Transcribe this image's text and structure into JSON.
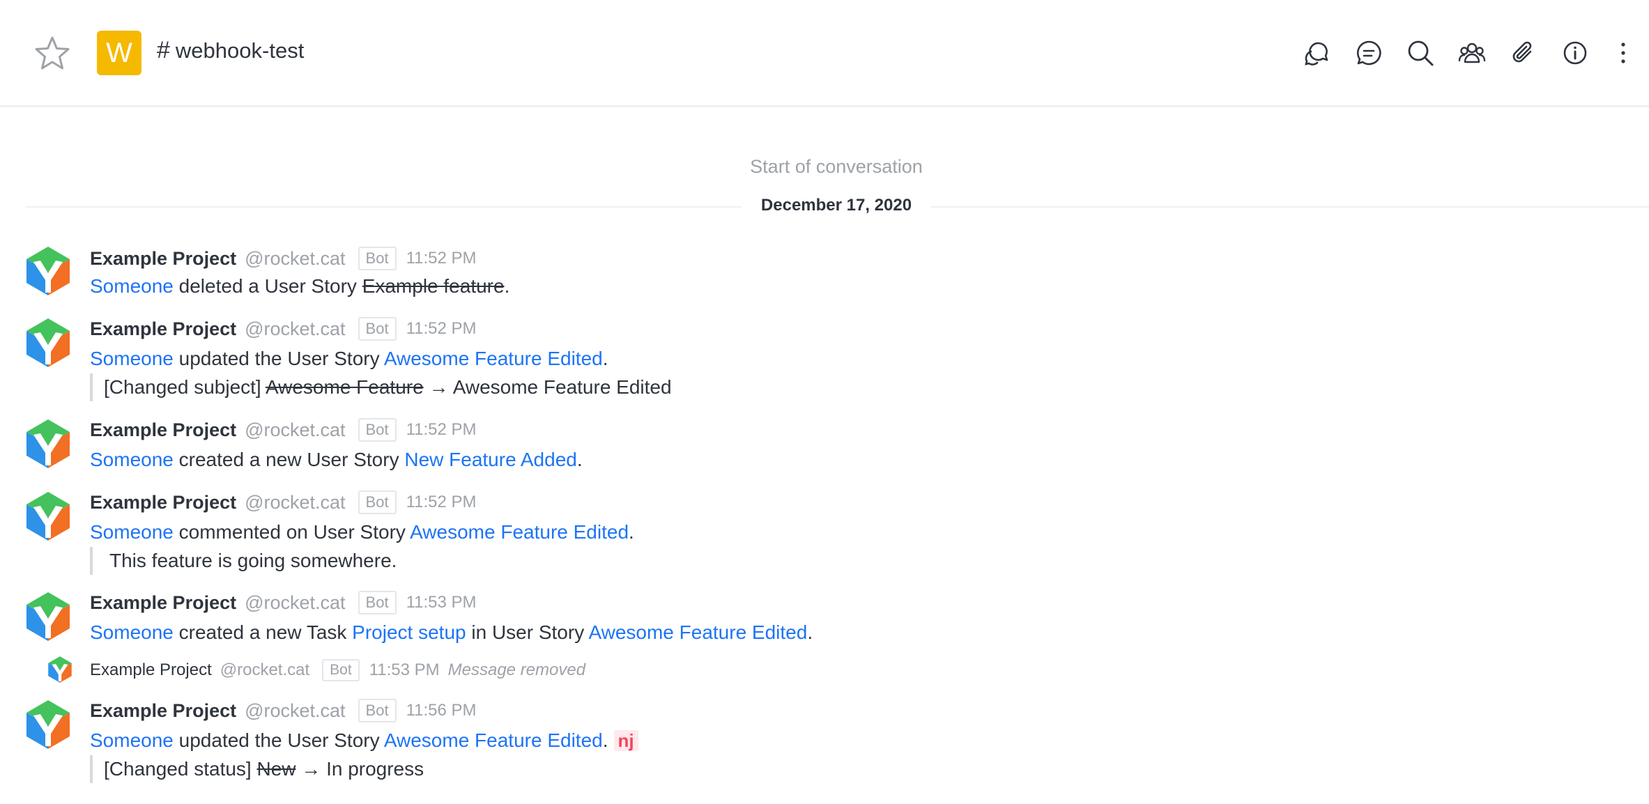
{
  "room": {
    "avatar_letter": "W",
    "hash": "#",
    "name": "webhook-test",
    "avatar_color": "#f5b900"
  },
  "toolbar": {
    "icons": [
      "threads-icon",
      "discussions-icon",
      "search-icon",
      "members-icon",
      "files-icon",
      "info-icon",
      "kebab-menu-icon"
    ]
  },
  "conversation": {
    "start_label": "Start of conversation",
    "date": "December 17, 2020"
  },
  "messages": [
    {
      "name": "Example Project",
      "username": "@rocket.cat",
      "badge": "Bot",
      "time": "11:52 PM",
      "parts": {
        "actor": "Someone",
        "t1": " deleted a User Story ",
        "struck": "Example feature",
        "t2": "."
      }
    },
    {
      "name": "Example Project",
      "username": "@rocket.cat",
      "badge": "Bot",
      "time": "11:52 PM",
      "parts": {
        "actor": "Someone",
        "t1": " updated the User Story ",
        "link": "Awesome Feature Edited",
        "t2": "."
      },
      "quote": {
        "prefix": "[Changed subject] ",
        "struck": "Awesome Feature",
        "arrow": " → ",
        "after": "Awesome Feature Edited"
      }
    },
    {
      "name": "Example Project",
      "username": "@rocket.cat",
      "badge": "Bot",
      "time": "11:52 PM",
      "parts": {
        "actor": "Someone",
        "t1": " created a new User Story ",
        "link": "New Feature Added",
        "t2": "."
      }
    },
    {
      "name": "Example Project",
      "username": "@rocket.cat",
      "badge": "Bot",
      "time": "11:52 PM",
      "parts": {
        "actor": "Someone",
        "t1": " commented on User Story ",
        "link": "Awesome Feature Edited",
        "t2": "."
      },
      "quote": {
        "text": "This feature is going somewhere."
      }
    },
    {
      "name": "Example Project",
      "username": "@rocket.cat",
      "badge": "Bot",
      "time": "11:53 PM",
      "parts": {
        "actor": "Someone",
        "t1": " created a new Task ",
        "link": "Project setup",
        "t2": " in User Story ",
        "link2": "Awesome Feature Edited",
        "t3": "."
      }
    },
    {
      "name": "Example Project",
      "username": "@rocket.cat",
      "badge": "Bot",
      "time": "11:53 PM",
      "removed": "Message removed"
    },
    {
      "name": "Example Project",
      "username": "@rocket.cat",
      "badge": "Bot",
      "time": "11:56 PM",
      "parts": {
        "actor": "Someone",
        "t1": " updated the User Story ",
        "link": "Awesome Feature Edited",
        "t2": ".",
        "mention": "nj"
      },
      "quote": {
        "prefix": "[Changed status] ",
        "struck": "New",
        "arrow": " → ",
        "after": "In progress"
      }
    }
  ],
  "colors": {
    "link": "#1d74f5",
    "muted": "#9ea2a8",
    "text": "#2f343d",
    "mention_bg": "#ffe9ec",
    "mention_fg": "#f5455c"
  }
}
